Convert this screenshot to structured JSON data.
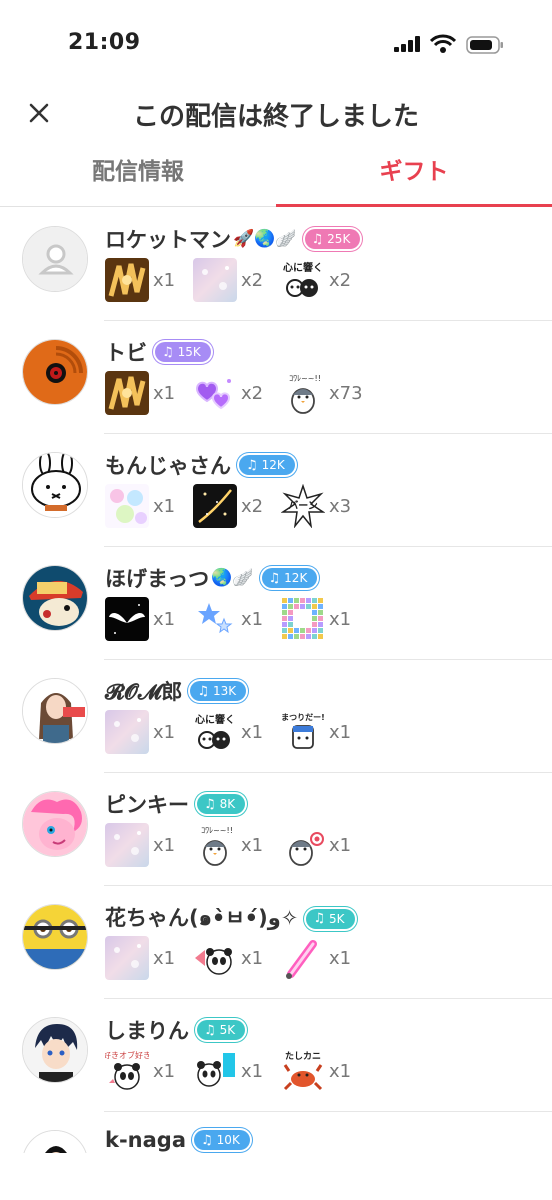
{
  "status_bar": {
    "time": "21:09"
  },
  "header": {
    "title": "この配信は終了しました"
  },
  "tabs": [
    {
      "label": "配信情報"
    },
    {
      "label": "ギフト"
    }
  ],
  "colors": {
    "accent": "#e8404f",
    "badge_pink": "#ef79b4",
    "badge_purple": "#a78cf5",
    "badge_blue": "#4aa8ef",
    "badge_teal": "#3cc7c6"
  },
  "users": [
    {
      "name": "ロケットマン",
      "deco": "🚀🌏🪽",
      "badge": "25K",
      "badge_color": "#ef79b4",
      "avatar": "default-avatar",
      "gifts": [
        {
          "icon": "gold-gift",
          "count": "x1"
        },
        {
          "icon": "sparkle-gift",
          "count": "x2"
        },
        {
          "icon": "heart-message-gift",
          "count": "x2"
        }
      ]
    },
    {
      "name": "トビ",
      "deco": "",
      "badge": "15K",
      "badge_color": "#a78cf5",
      "avatar": "orange-mask-avatar",
      "gifts": [
        {
          "icon": "gold-gift",
          "count": "x1"
        },
        {
          "icon": "purple-hearts-gift",
          "count": "x2"
        },
        {
          "icon": "penguin-gift",
          "count": "x73"
        }
      ]
    },
    {
      "name": "もんじゃさん",
      "deco": "",
      "badge": "12K",
      "badge_color": "#4aa8ef",
      "avatar": "bunny-avatar",
      "gifts": [
        {
          "icon": "bubbles-gift",
          "count": "x1"
        },
        {
          "icon": "firework-gift",
          "count": "x2"
        },
        {
          "icon": "burst-gift",
          "count": "x3"
        }
      ]
    },
    {
      "name": "ほげまっつ",
      "deco": "🌏🪽",
      "badge": "12K",
      "badge_color": "#4aa8ef",
      "avatar": "cartoon-hat-avatar",
      "gifts": [
        {
          "icon": "wings-gift",
          "count": "x1"
        },
        {
          "icon": "stars-gift",
          "count": "x1"
        },
        {
          "icon": "mosaic-gift",
          "count": "x1"
        }
      ]
    },
    {
      "name": "𝓡𝓞𝓜郎",
      "deco": "",
      "badge": "13K",
      "badge_color": "#4aa8ef",
      "avatar": "girl-avatar",
      "gifts": [
        {
          "icon": "sparkle-gift",
          "count": "x1"
        },
        {
          "icon": "heart-message-gift",
          "count": "x1"
        },
        {
          "icon": "festival-gift",
          "count": "x1"
        }
      ]
    },
    {
      "name": "ピンキー",
      "deco": "",
      "badge": "8K",
      "badge_color": "#3cc7c6",
      "avatar": "pink-pony-avatar",
      "gifts": [
        {
          "icon": "sparkle-gift",
          "count": "x1"
        },
        {
          "icon": "penguin-gift",
          "count": "x1"
        },
        {
          "icon": "penguin-flag-gift",
          "count": "x1"
        }
      ]
    },
    {
      "name": "花ちゃん(๑•̀ㅂ•́)و✧",
      "deco": "",
      "badge": "5K",
      "badge_color": "#3cc7c6",
      "avatar": "minion-avatar",
      "gifts": [
        {
          "icon": "sparkle-gift",
          "count": "x1"
        },
        {
          "icon": "panda-fan-gift",
          "count": "x1"
        },
        {
          "icon": "glowstick-gift",
          "count": "x1"
        }
      ]
    },
    {
      "name": "しまりん",
      "deco": "",
      "badge": "5K",
      "badge_color": "#3cc7c6",
      "avatar": "anime-boy-avatar",
      "gifts": [
        {
          "icon": "panda-love-gift",
          "count": "x1"
        },
        {
          "icon": "panda-sign-gift",
          "count": "x1"
        },
        {
          "icon": "crab-gift",
          "count": "x1"
        }
      ]
    },
    {
      "name": "k-naga",
      "deco": "",
      "badge": "10K",
      "badge_color": "#4aa8ef",
      "avatar": "boy-avatar",
      "gifts": []
    }
  ]
}
